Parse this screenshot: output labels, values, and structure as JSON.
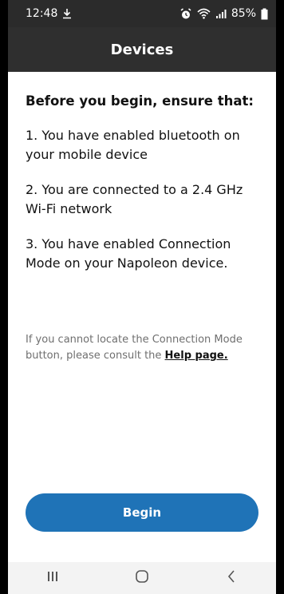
{
  "status_bar": {
    "time": "12:48",
    "battery": "85%"
  },
  "app_bar": {
    "title": "Devices"
  },
  "content": {
    "heading": "Before you begin, ensure that:",
    "steps": [
      "1. You have enabled bluetooth on your mobile device",
      "2. You are connected to a 2.4 GHz Wi-Fi network",
      "3. You have enabled Connection Mode on your Napoleon device."
    ],
    "help_prefix": "If you cannot locate the Connection Mode button, please consult the ",
    "help_link": "Help page."
  },
  "actions": {
    "begin_label": "Begin"
  },
  "colors": {
    "primary": "#1f73b7",
    "app_bar": "#2f2f2f",
    "status_bar": "#2b2b2b"
  },
  "icons": {
    "status_left": [
      "download-icon"
    ],
    "status_right": [
      "alarm-icon",
      "wifi-icon",
      "signal-icon",
      "battery-icon"
    ],
    "nav": [
      "recent-apps-icon",
      "home-icon",
      "back-icon"
    ]
  }
}
